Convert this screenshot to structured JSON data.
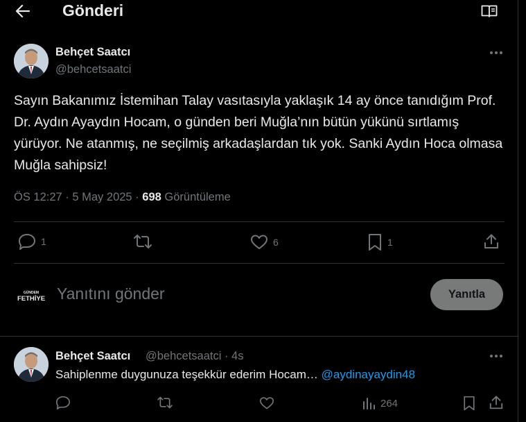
{
  "header": {
    "title": "Gönderi"
  },
  "tweet": {
    "author_name": "Behçet Saatcı",
    "author_handle": "@behcetsaatci",
    "text": "Sayın Bakanımız İstemihan Talay vasıtasıyla yaklaşık 14 ay önce tanıdığım Prof. Dr. Aydın Ayaydın Hocam, o günden beri Muğla’nın bütün yükünü sırtlamış yürüyor. Ne atanmış, ne seçilmiş arkadaşlardan tık yok. Sanki Aydın Hoca olmasa Muğla sahipsiz!",
    "time_date": "ÖS 12:27 · 5 May 2025 · ",
    "views_count": "698",
    "views_label": " Görüntüleme",
    "actions": {
      "replies": "1",
      "retweets": "",
      "likes": "6",
      "bookmarks": "1"
    }
  },
  "composer": {
    "logo_text_top": "GÜNDEM",
    "logo_text_bottom": "FETHİYE",
    "placeholder": "Yanıtını gönder",
    "reply_button": "Yanıtla"
  },
  "reply": {
    "author_name": "Behçet Saatcı",
    "author_handle_time": "@behcetsaatci · 4s",
    "text": "Sahiplenme duygunuza teşekkür ederim Hocam… ",
    "mention": "@aydinayaydin48",
    "views": "264"
  },
  "colors": {
    "background": "#000000",
    "text": "#e7e9ea",
    "muted": "#71767b",
    "link": "#1d9bf0",
    "border": "#2f3336"
  }
}
